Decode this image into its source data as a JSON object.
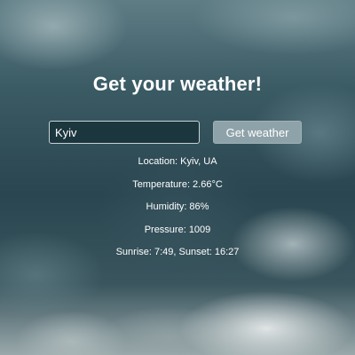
{
  "page": {
    "title": "Get your weather!"
  },
  "form": {
    "city_value": "Kyiv",
    "button_label": "Get weather"
  },
  "weather": {
    "location": "Location: Kyiv, UA",
    "temperature": "Temperature: 2.66°C",
    "humidity": "Humidity: 86%",
    "pressure": "Pressure: 1009",
    "sun": "Sunrise: 7:49, Sunset: 16:27"
  },
  "colors": {
    "button_bg": "#8ea3a9",
    "input_border": "#c9d3d6",
    "text": "#ffffff"
  }
}
